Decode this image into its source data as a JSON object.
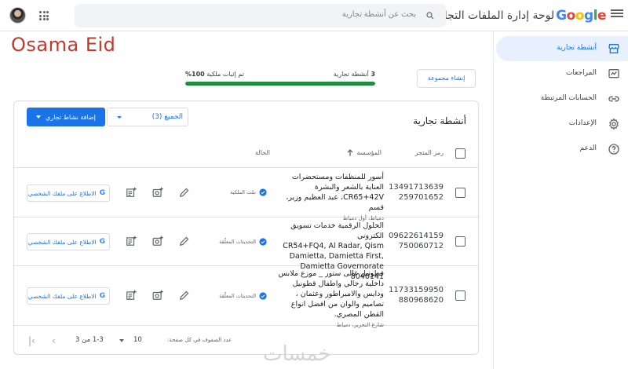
{
  "header": {
    "logo_google": [
      "G",
      "o",
      "o",
      "g",
      "l",
      "e"
    ],
    "product_name": "لوحة إدارة الملفات التجارية",
    "search_placeholder": "بحث عن أنشطة تجارية"
  },
  "owner_name": "Osama Eid",
  "progress": {
    "businesses_label": "أنشطة تجارية",
    "businesses_count": "3",
    "verified_label": "تم إثبات ملكية",
    "verified_percent": "100%",
    "fill_fraction": 1.0
  },
  "create_group_label": "إنشاء مجموعة",
  "sidebar": {
    "items": [
      {
        "label": "أنشطة تجارية",
        "icon": "storefront-icon",
        "active": true
      },
      {
        "label": "المراجعات",
        "icon": "reviews-icon"
      },
      {
        "label": "الحسابات المرتبطة",
        "icon": "link-icon"
      },
      {
        "label": "الإعدادات",
        "icon": "gear-icon"
      },
      {
        "label": "الدعم",
        "icon": "help-icon"
      }
    ]
  },
  "card": {
    "title": "أنشطة تجارية",
    "add_button": "إضافة نشاط تجاري",
    "group_select": "الجميع (3)"
  },
  "table": {
    "headers": {
      "store_code": "رمز المتجر",
      "business": "المؤسسة",
      "status": "الحالة"
    },
    "rows": [
      {
        "code": [
          "13491713639",
          "259701652"
        ],
        "name": "أسور للمنظفات ومستحضرات العناية بالشعر والبشرة",
        "address": "CR65+42V، عبد العظيم وزير، قسم",
        "city": "دمياط، أول دمياط",
        "status": "تمّت الملكية",
        "profile_button": "الاطلاع على ملفك الشخصي"
      },
      {
        "code": [
          "09622614159",
          "750060712"
        ],
        "name": "الحلول الرقمية خدمات تسويق الكتروني",
        "address": "CR54+FQ4, Al Radar, Qism Damietta, Damietta First, Damietta Governorate 8040141",
        "city": "",
        "status": "التحديثات المعلّقة",
        "profile_button": "الاطلاع على ملفك الشخصي"
      },
      {
        "code": [
          "11733159950",
          "880968620"
        ],
        "name": "قطونيل غالى ستور _ موزع ملابس داخلية رجالي واطفال قطونيل ودايس والامبراطور وعثمان ، تصاميم والوان من افضل انواع القطن المصري.",
        "address": "",
        "city": "شارع التحرير، دمياط",
        "status": "التحديثات المعلّقة",
        "profile_button": "الاطلاع على ملفك الشخصي"
      }
    ]
  },
  "pagination": {
    "rows_per_page_label": "عدد الصفوف في كل صفحة:",
    "rows_per_page": "10",
    "range": "1-3 من 3",
    "prev": "‹",
    "first": "|‹"
  },
  "watermark": "خمسات",
  "colors": {
    "accent": "#1a73e8",
    "progress": "#1e8e3e",
    "owner_text": "#c0392b"
  }
}
